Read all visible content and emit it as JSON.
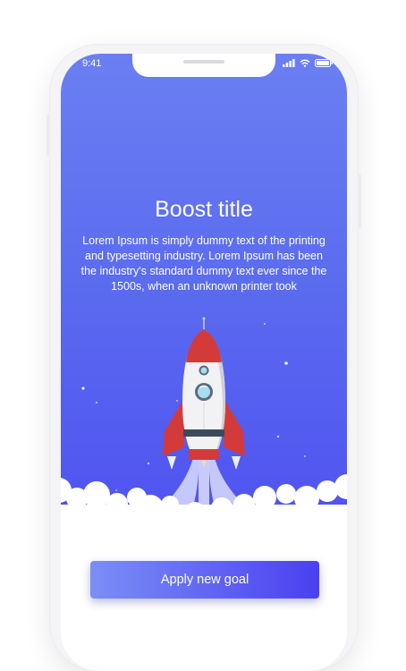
{
  "status_bar": {
    "time": "9:41"
  },
  "hero": {
    "title": "Boost title",
    "description": "Lorem Ipsum is simply dummy text of the printing and typesetting industry. Lorem Ipsum has been the industry's standard dummy text ever since the 1500s, when an unknown printer took"
  },
  "actions": {
    "apply_label": "Apply new goal"
  },
  "colors": {
    "gradient_top": "#6b7ff2",
    "gradient_bottom": "#4e4ff0",
    "button_start": "#7b8ef6",
    "button_end": "#4a40f0",
    "rocket_red": "#d33b3b",
    "rocket_body": "#f2f2f4"
  },
  "icons": [
    "signal-icon",
    "wifi-icon",
    "battery-icon",
    "rocket-illustration"
  ]
}
